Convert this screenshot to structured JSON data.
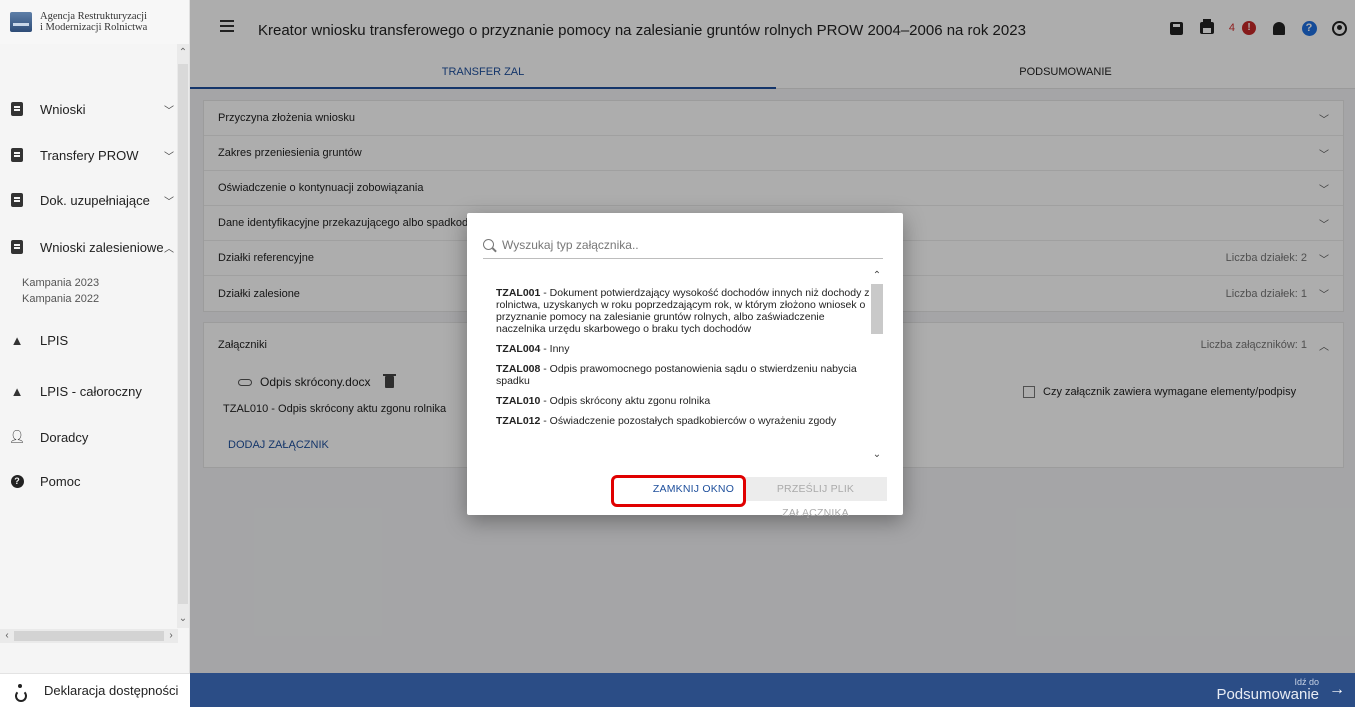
{
  "logo": {
    "line1": "Agencja Restrukturyzacji",
    "line2": "i Modernizacji Rolnictwa"
  },
  "sidebar": {
    "items": [
      {
        "label": "Wnioski",
        "icon": "document-icon"
      },
      {
        "label": "Transfery PROW",
        "icon": "document-icon"
      },
      {
        "label": "Dok. uzupełniające",
        "icon": "document-icon"
      },
      {
        "label": "Wnioski zalesieniowe",
        "icon": "document-icon"
      },
      {
        "label": "LPIS",
        "icon": "mountain-icon"
      },
      {
        "label": "LPIS - całoroczny",
        "icon": "mountain-icon"
      },
      {
        "label": "Doradcy",
        "icon": "person-icon"
      },
      {
        "label": "Pomoc",
        "icon": "question-icon"
      }
    ],
    "subitems": [
      "Kampania 2023",
      "Kampania 2022"
    ],
    "footer_label": "Deklaracja dostępności"
  },
  "header": {
    "title": "Kreator wniosku transferowego o przyznanie pomocy na zalesianie gruntów rolnych PROW 2004–2006 na rok 2023",
    "notification_count": "4",
    "alert_glyph": "!",
    "help_glyph": "?"
  },
  "tabs": [
    {
      "label": "TRANSFER ZAL",
      "active": true
    },
    {
      "label": "PODSUMOWANIE",
      "active": false
    }
  ],
  "sections": [
    {
      "label": "Przyczyna złożenia wniosku",
      "meta": ""
    },
    {
      "label": "Zakres przeniesienia gruntów",
      "meta": ""
    },
    {
      "label": "Oświadczenie o kontynuacji zobowiązania",
      "meta": ""
    },
    {
      "label": "Dane identyfikacyjne przekazującego albo spadkod",
      "meta": ""
    },
    {
      "label": "Działki referencyjne",
      "meta": "Liczba działek: 2"
    },
    {
      "label": "Działki zalesione",
      "meta": "Liczba działek: 1"
    }
  ],
  "attachments": {
    "label": "Załączniki",
    "meta": "Liczba załączników: 1",
    "file_name": "Odpis skrócony.docx",
    "file_type": "TZAL010 - Odpis skrócony aktu zgonu rolnika",
    "add_label": "DODAJ ZAŁĄCZNIK",
    "checkbox_label": "Czy załącznik zawiera wymagane elementy/podpisy"
  },
  "modal": {
    "search_placeholder": "Wyszukaj typ załącznika..",
    "options": [
      {
        "code": "TZAL001",
        "text": " - Dokument potwierdzający wysokość dochodów innych niż dochody z rolnictwa, uzyskanych w roku poprzedzającym rok, w którym złożono wniosek o przyznanie pomocy na zalesianie gruntów rolnych, albo zaświadczenie naczelnika urzędu skarbowego o braku tych dochodów"
      },
      {
        "code": "TZAL004",
        "text": " - Inny"
      },
      {
        "code": "TZAL008",
        "text": " - Odpis prawomocnego postanowienia sądu o stwierdzeniu nabycia spadku"
      },
      {
        "code": "TZAL010",
        "text": " - Odpis skrócony aktu zgonu rolnika"
      },
      {
        "code": "TZAL012",
        "text": " - Oświadczenie pozostałych spadkobierców o wyrażeniu zgody"
      }
    ],
    "close_label": "ZAMKNIJ OKNO",
    "upload_label": "PRZEŚLIJ PLIK ZAŁĄCZNIKA"
  },
  "footer": {
    "next_small": "Idź do",
    "next_big": "Podsumowanie"
  },
  "colors": {
    "accent": "#1e4f9c",
    "footer": "#2b4d86",
    "highlight": "#e00000",
    "alert": "#c62828"
  }
}
